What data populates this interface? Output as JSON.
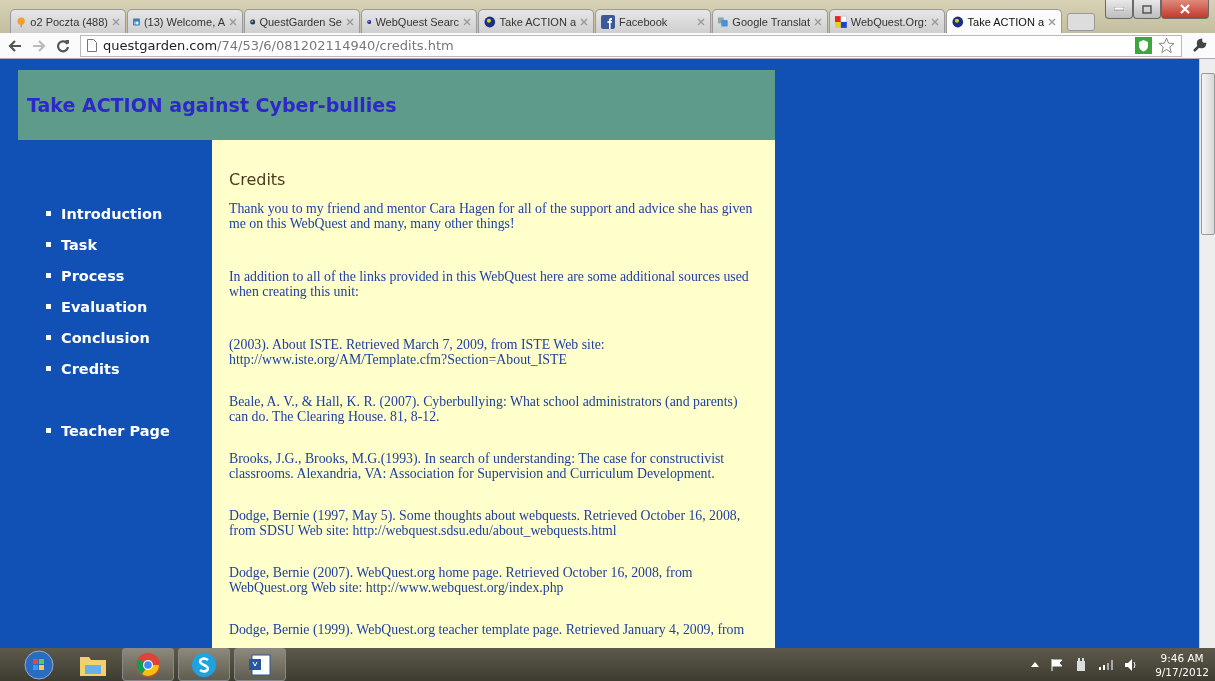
{
  "browser": {
    "tabs": [
      {
        "kind": "balloon",
        "title": "o2 Poczta (488)",
        "selected": false
      },
      {
        "kind": "linkedin",
        "title": "(13) Welcome, A",
        "selected": false
      },
      {
        "kind": "globe",
        "title": "QuestGarden Se",
        "selected": false
      },
      {
        "kind": "globe",
        "title": "WebQuest Searc",
        "selected": false
      },
      {
        "kind": "globe",
        "title": "Take ACTION a",
        "selected": false
      },
      {
        "kind": "facebook",
        "title": "Facebook",
        "selected": false
      },
      {
        "kind": "translate",
        "title": "Google Translat",
        "selected": false
      },
      {
        "kind": "squares",
        "title": "WebQuest.Org:",
        "selected": false
      },
      {
        "kind": "globe",
        "title": "Take ACTION a",
        "selected": true
      }
    ],
    "address": {
      "host": "questgarden.com",
      "path": "/74/53/6/081202114940/credits.htm"
    }
  },
  "page": {
    "title": "Take ACTION against Cyber-bullies",
    "nav": [
      {
        "label": "Introduction"
      },
      {
        "label": "Task"
      },
      {
        "label": "Process"
      },
      {
        "label": "Evaluation"
      },
      {
        "label": "Conclusion"
      },
      {
        "label": "Credits"
      }
    ],
    "teacher_link": "Teacher Page",
    "heading": "Credits",
    "paragraphs": [
      {
        "kind": "note",
        "text": "Thank you to my friend and mentor Cara Hagen for all of the support and advice she has given me on this WebQuest and many, many other things!"
      },
      {
        "kind": "note",
        "text": "In addition to all of the links provided in this WebQuest here are some additional sources used when creating this unit:"
      },
      {
        "kind": "reference",
        "text": "(2003). About ISTE. Retrieved March 7, 2009, from ISTE Web site: http://www.iste.org/AM/Template.cfm?Section=About_ISTE"
      },
      {
        "kind": "reference",
        "text": "Beale, A. V., & Hall, K. R. (2007). Cyberbullying: What school administrators (and parents) can do. The Clearing House. 81, 8-12."
      },
      {
        "kind": "reference",
        "text": "Brooks, J.G., Brooks, M.G.(1993). In search of understanding: The case for constructivist classrooms. Alexandria, VA: Association for Supervision and Curriculum  Development."
      },
      {
        "kind": "reference",
        "text": "Dodge, Bernie (1997, May 5). Some thoughts about webquests. Retrieved October 16, 2008, from SDSU Web site: http://webquest.sdsu.edu/about_webquests.html"
      },
      {
        "kind": "reference",
        "text": "Dodge, Bernie (2007). WebQuest.org home page. Retrieved October 16, 2008, from WebQuest.org Web site: http://www.webquest.org/index.php"
      },
      {
        "kind": "reference",
        "text": "Dodge, Bernie (1999). WebQuest.org teacher template page. Retrieved January 4, 2009, from"
      }
    ]
  },
  "taskbar": {
    "time": "9:46 AM",
    "date": "9/17/2012"
  }
}
